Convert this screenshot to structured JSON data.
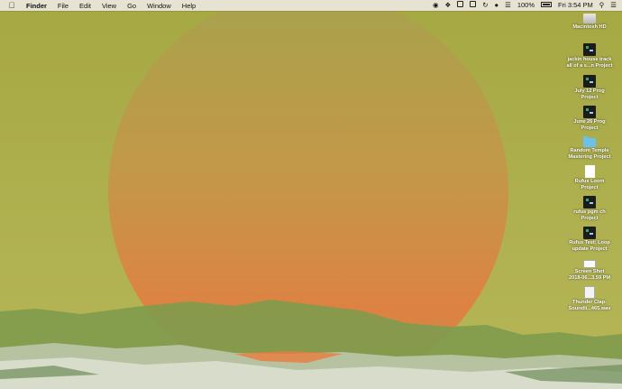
{
  "menubar": {
    "app_name": "Finder",
    "menus": [
      "File",
      "Edit",
      "View",
      "Go",
      "Window",
      "Help"
    ],
    "status": {
      "battery": "100%",
      "clock": "Fri 3:54 PM",
      "icons": [
        "creative-cloud-icon",
        "dropbox-icon",
        "icon-square-1",
        "icon-square-2",
        "sync-icon",
        "mic-icon",
        "wifi-icon",
        "battery-icon",
        "search-icon",
        "notification-list-icon"
      ]
    }
  },
  "desktop": {
    "items": [
      {
        "label1": "Macintosh HD",
        "label2": "",
        "icon": "disk"
      },
      {
        "label1": "jackin house track",
        "label2": "all of a s...n Project",
        "icon": "term"
      },
      {
        "label1": "July 12 Prog",
        "label2": "Project",
        "icon": "term"
      },
      {
        "label1": "June 26 Prog",
        "label2": "Project",
        "icon": "term"
      },
      {
        "label1": "Random Temple",
        "label2": "Mastering Project",
        "icon": "folder"
      },
      {
        "label1": "Rufus Loom",
        "label2": "Project",
        "icon": "doc"
      },
      {
        "label1": "rufus pgm ch",
        "label2": "Project",
        "icon": "term"
      },
      {
        "label1": "Rufus Test: Loop",
        "label2": "update Project",
        "icon": "term"
      },
      {
        "label1": "Screen Shot",
        "label2": "2018-06...3.59 PM",
        "icon": "shot"
      },
      {
        "label1": "Thunder Clap-",
        "label2": "Soundli...465.wav",
        "icon": "audio"
      }
    ]
  },
  "colors": {
    "sky": "#a9aa48",
    "sun": "#e87a3d",
    "ground": "#7f9a4f"
  }
}
